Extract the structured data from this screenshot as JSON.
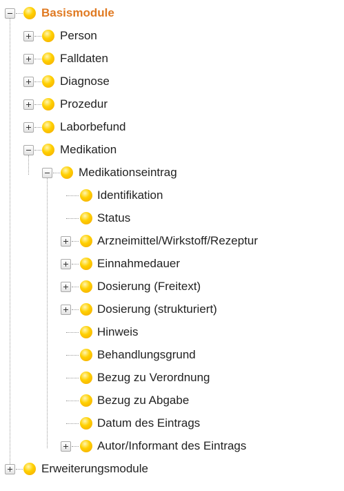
{
  "tree": {
    "root": {
      "label": "Basismodule",
      "children": [
        {
          "label": "Person"
        },
        {
          "label": "Falldaten"
        },
        {
          "label": "Diagnose"
        },
        {
          "label": "Prozedur"
        },
        {
          "label": "Laborbefund"
        },
        {
          "label": "Medikation",
          "children": [
            {
              "label": "Medikationseintrag",
              "children": [
                {
                  "label": "Identifikation"
                },
                {
                  "label": "Status"
                },
                {
                  "label": "Arzneimittel/Wirkstoff/Rezeptur"
                },
                {
                  "label": "Einnahmedauer"
                },
                {
                  "label": "Dosierung (Freitext)"
                },
                {
                  "label": "Dosierung (strukturiert)"
                },
                {
                  "label": "Hinweis"
                },
                {
                  "label": "Behandlungsgrund"
                },
                {
                  "label": "Bezug zu Verordnung"
                },
                {
                  "label": "Bezug zu Abgabe"
                },
                {
                  "label": "Datum des Eintrags"
                },
                {
                  "label": "Autor/Informant des Eintrags"
                }
              ]
            }
          ]
        }
      ]
    },
    "sibling": {
      "label": "Erweiterungsmodule"
    }
  },
  "colors": {
    "root_label": "#e07a22",
    "node_icon": "#ffc400",
    "connector": "#9a9a9a"
  },
  "icons": {
    "node": "yellow-orb-icon",
    "expanded": "collapse-minus-icon",
    "collapsed": "expand-plus-icon"
  }
}
